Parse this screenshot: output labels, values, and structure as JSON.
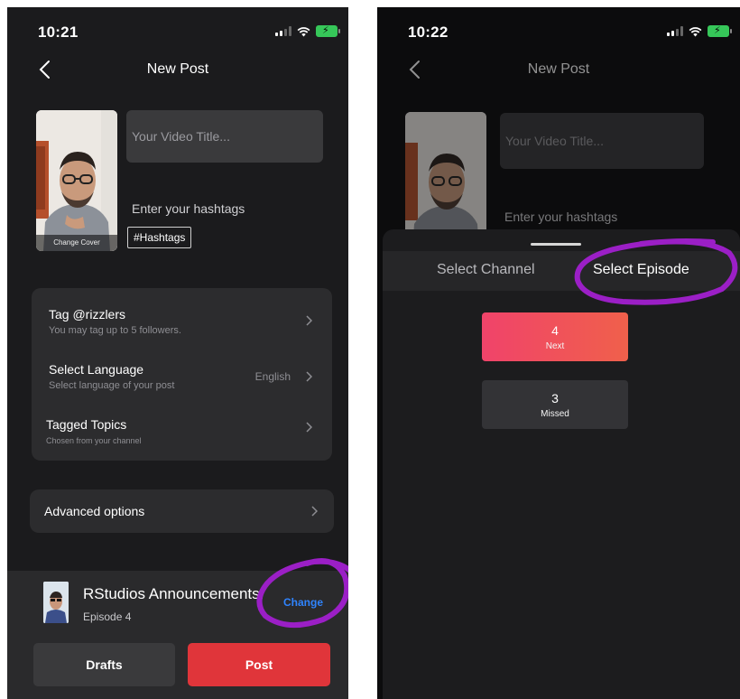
{
  "left": {
    "status_time": "10:21",
    "nav_title": "New Post",
    "cover_label": "Change Cover",
    "title_placeholder": "Your Video Title...",
    "hashtags_label": "Enter your hashtags",
    "hashtag_chip": "#Hashtags",
    "settings": [
      {
        "title": "Tag @rizzlers",
        "subtitle": "You may tag up to 5 followers.",
        "value": ""
      },
      {
        "title": "Select Language",
        "subtitle": "Select language of your post",
        "value": "English"
      },
      {
        "title": "Tagged Topics",
        "subtitle": "Chosen from your channel",
        "value": ""
      }
    ],
    "advanced_label": "Advanced options",
    "channel": {
      "name": "RStudios Announcements!",
      "episode": "Episode 4",
      "change_label": "Change"
    },
    "drafts_label": "Drafts",
    "post_label": "Post"
  },
  "right": {
    "status_time": "10:22",
    "nav_title": "New Post",
    "title_placeholder": "Your Video Title...",
    "hashtags_label": "Enter your hashtags",
    "tabs": [
      {
        "label": "Select Channel"
      },
      {
        "label": "Select Episode"
      }
    ],
    "episodes": [
      {
        "number": "4",
        "status": "Next"
      },
      {
        "number": "3",
        "status": "Missed"
      }
    ]
  },
  "colors": {
    "post_button": "#e0353a",
    "change_link": "#2f84ff",
    "annotation": "#9b1fc6",
    "episode_next": "#f0506a"
  }
}
